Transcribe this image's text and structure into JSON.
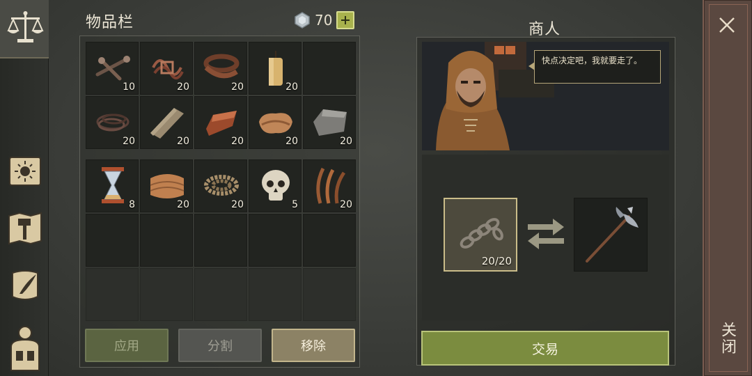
{
  "sidebar": {
    "items": [
      {
        "icon": "scales-icon",
        "active": true
      },
      {
        "icon": "sun-book-icon",
        "active": false
      },
      {
        "icon": "hammer-map-icon",
        "active": false
      },
      {
        "icon": "quill-scroll-icon",
        "active": false
      },
      {
        "icon": "backpack-character-icon",
        "active": false
      }
    ]
  },
  "inventory": {
    "title": "物品栏",
    "currency": {
      "icon": "gem-icon",
      "value": "70"
    },
    "cells": [
      {
        "icon": "nails-icon",
        "qty": "10"
      },
      {
        "icon": "sinew-icon",
        "qty": "20"
      },
      {
        "icon": "leather-strap-icon",
        "qty": "20"
      },
      {
        "icon": "candle-icon",
        "qty": "20"
      },
      {
        "icon": "",
        "qty": ""
      },
      {
        "icon": "wire-icon",
        "qty": "20"
      },
      {
        "icon": "planks-icon",
        "qty": "20"
      },
      {
        "icon": "copper-ingot-icon",
        "qty": "20"
      },
      {
        "icon": "leather-icon",
        "qty": "20"
      },
      {
        "icon": "stone-block-icon",
        "qty": "20"
      },
      {
        "icon": "hourglass-icon",
        "qty": "8"
      },
      {
        "icon": "cloth-icon",
        "qty": "20"
      },
      {
        "icon": "rope-icon",
        "qty": "20"
      },
      {
        "icon": "skull-icon",
        "qty": "5"
      },
      {
        "icon": "herbs-icon",
        "qty": "20"
      }
    ],
    "buttons": {
      "apply": "应用",
      "split": "分割",
      "remove": "移除"
    }
  },
  "merchant": {
    "title": "商人",
    "speech": "快点决定吧，我就要走了。",
    "give": {
      "icon": "chain-icon",
      "qty": "20/20"
    },
    "get": {
      "icon": "halberd-icon"
    },
    "trade_label": "交易"
  },
  "close": {
    "label": "关闭"
  },
  "colors": {
    "accent_green": "#7b8c3f",
    "highlight_gold": "#cbbd8a",
    "panel_dark": "#222420"
  }
}
